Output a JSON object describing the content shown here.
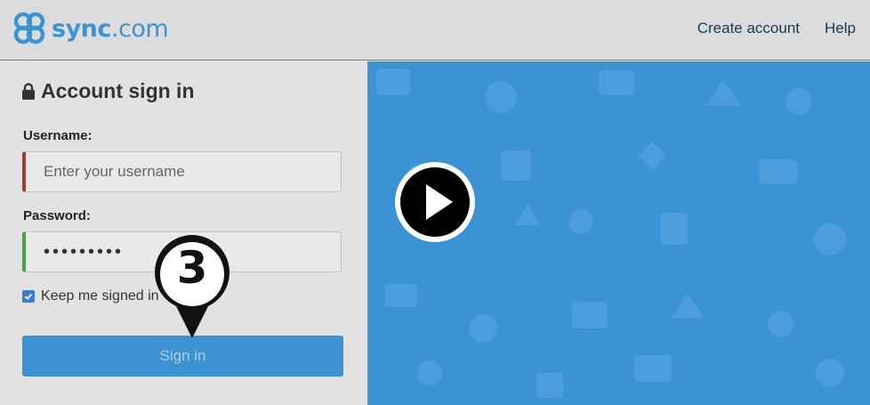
{
  "header": {
    "logo_text_brand": "sync",
    "logo_text_domain": ".com",
    "nav": [
      "Create account",
      "Help"
    ]
  },
  "signin": {
    "title": "Account sign in",
    "username_label": "Username:",
    "username_placeholder": "Enter your username",
    "password_label": "Password:",
    "password_value": "•••••••••",
    "remember_label": "Keep me signed in",
    "remember_checked": true,
    "submit_label": "Sign in"
  },
  "annotation": {
    "step_number": "3"
  },
  "colors": {
    "brand_blue": "#3b93d5",
    "hero_blue": "#3b92d4",
    "username_border": "#a33a3a",
    "password_border": "#4aa24a"
  }
}
